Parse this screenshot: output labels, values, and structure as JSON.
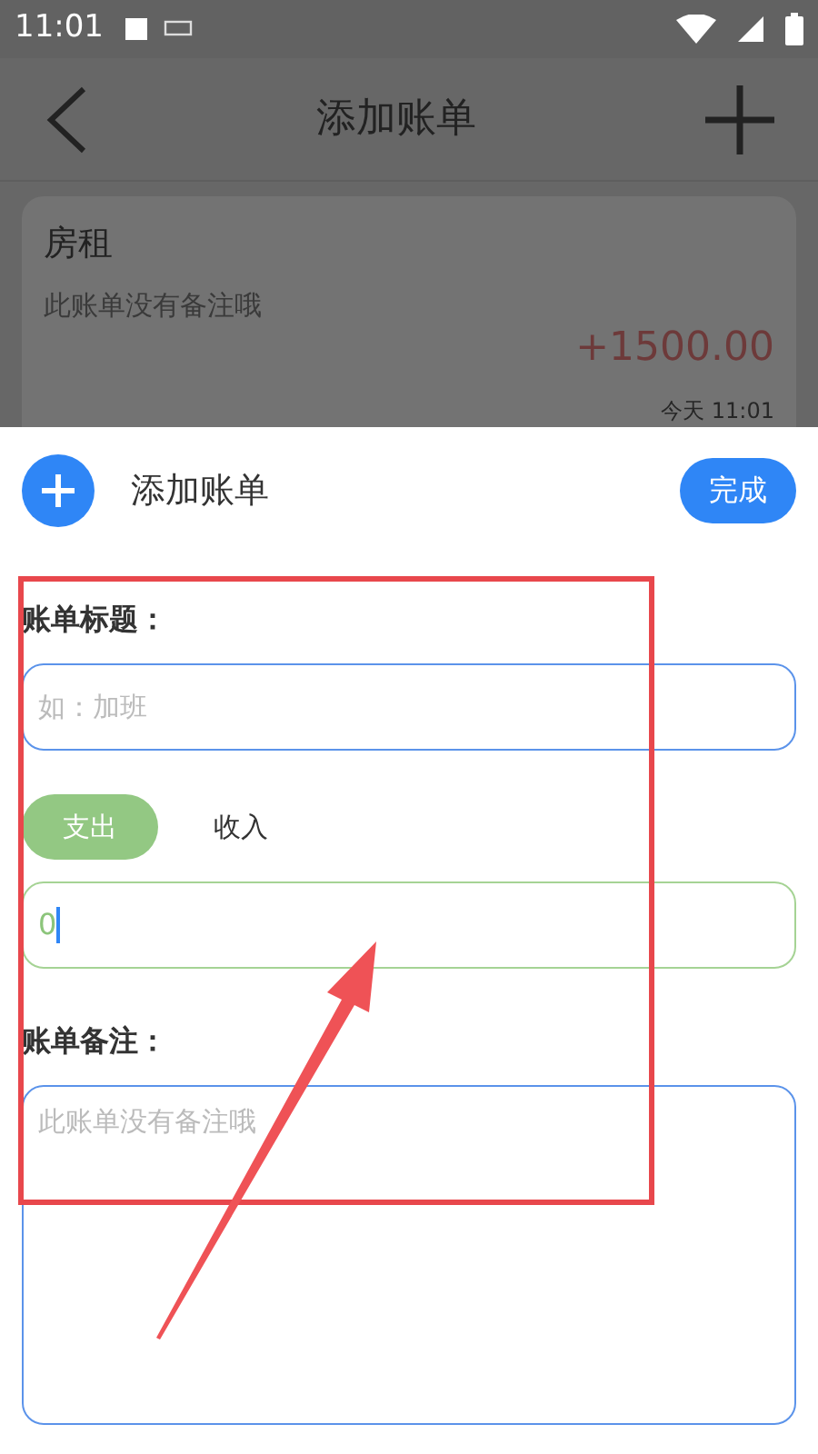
{
  "status_bar": {
    "time": "11:01"
  },
  "header": {
    "title": "添加账单"
  },
  "record": {
    "title": "房租",
    "note": "此账单没有备注哦",
    "amount": "+1500.00",
    "time": "今天 11:01"
  },
  "sheet": {
    "title": "添加账单",
    "done": "完成",
    "title_label": "账单标题：",
    "title_placeholder": "如：加班",
    "type_options": [
      {
        "label": "支出",
        "selected": true
      },
      {
        "label": "收入",
        "selected": false
      }
    ],
    "amount_value": "0",
    "note_label": "账单备注：",
    "note_placeholder": "此账单没有备注哦"
  }
}
